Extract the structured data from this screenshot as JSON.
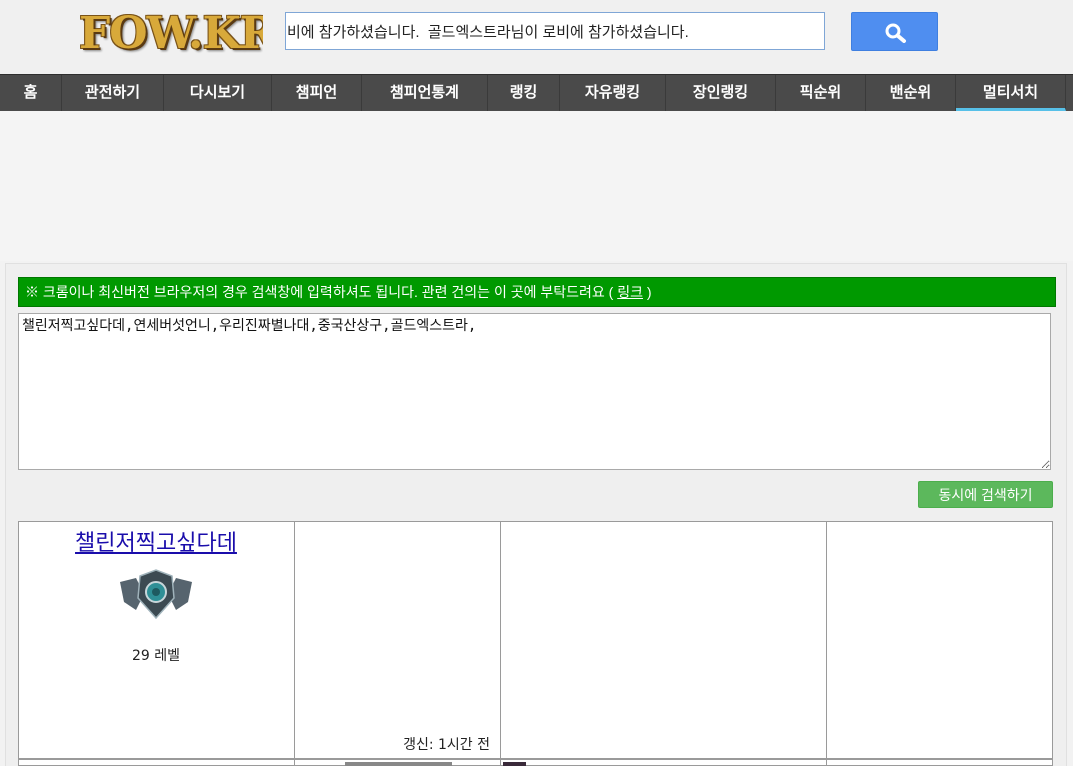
{
  "header": {
    "logo_text": "FOW.KR",
    "search_value": "비에 참가하셨습니다.  골드엑스트라님이 로비에 참가하셨습니다."
  },
  "nav": {
    "items": [
      {
        "label": "홈"
      },
      {
        "label": "관전하기"
      },
      {
        "label": "다시보기"
      },
      {
        "label": "챔피언"
      },
      {
        "label": "챔피언통계"
      },
      {
        "label": "랭킹"
      },
      {
        "label": "자유랭킹"
      },
      {
        "label": "장인랭킹"
      },
      {
        "label": "픽순위"
      },
      {
        "label": "밴순위"
      },
      {
        "label": "멀티서치"
      }
    ],
    "active": "멀티서치"
  },
  "multisearch": {
    "notice_text": "※ 크롬이나 최신버전 브라우저의 경우 검색창에 입력하셔도 됩니다. 관련 건의는 이 곳에 부탁드려요 (",
    "notice_link": "링크",
    "notice_close": " )",
    "names_value": "챌린저찍고싶다데,연세버섯언니,우리진짜별나대,중국산상구,골드엑스트라,",
    "submit_label": "동시에 검색하기"
  },
  "results": [
    {
      "name": "챌린저찍고싶다데",
      "emblem": "rank-emblem-icon",
      "level": "29 레벨",
      "updated": "갱신: 1시간 전"
    }
  ],
  "colors": {
    "nav_bg": "#4a4a4a",
    "nav_active_underline": "#57c0e8",
    "search_button": "#4f8ef0",
    "notice_bg": "#009900",
    "submit_button": "#5cb85c",
    "link": "#1a0dab"
  }
}
